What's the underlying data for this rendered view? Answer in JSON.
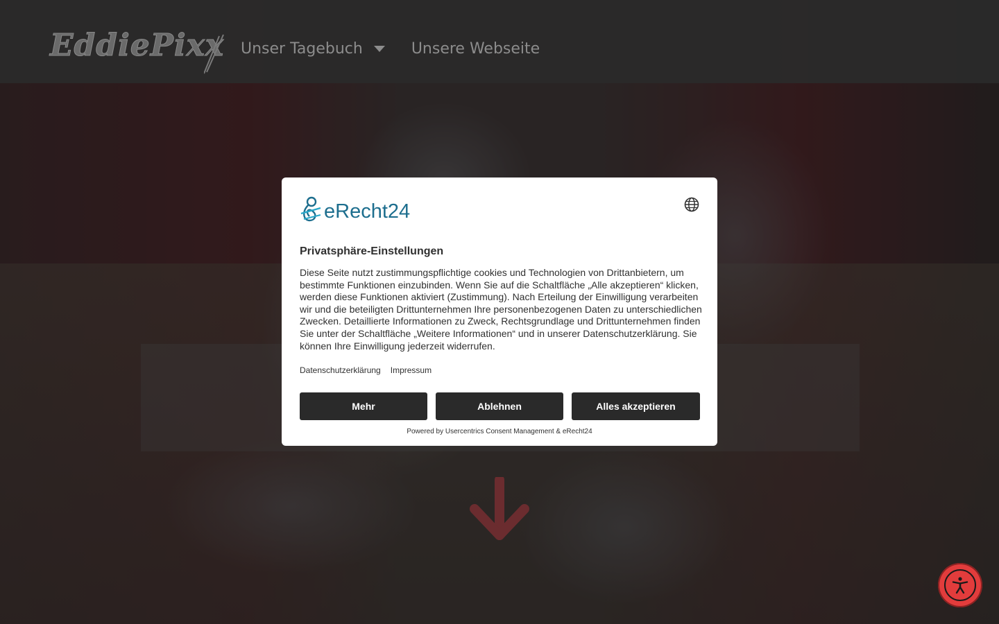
{
  "site": {
    "logo_text": "EddiePixx",
    "nav": [
      {
        "label": "Unser Tagebuch",
        "has_dropdown": true
      },
      {
        "label": "Unsere Webseite",
        "has_dropdown": false
      }
    ]
  },
  "consent": {
    "brand": "eRecht24",
    "title": "Privatsphäre-Einstellungen",
    "body": "Diese Seite nutzt zustimmungspflichtige cookies und Technologien von Drittanbietern, um bestimmte Funktionen einzubinden. Wenn Sie auf die Schaltfläche „Alle akzeptieren“ klicken, werden diese Funktionen aktiviert (Zustimmung). Nach Erteilung der Einwilligung verarbeiten wir und die beteiligten Drittunternehmen Ihre personenbezogenen Daten zu unterschiedlichen Zwecken. Detaillierte Informationen zu Zweck, Rechtsgrundlage und Drittunternehmen finden Sie unter der Schaltfläche „Weitere Informationen“ und in unserer Datenschutzerklärung. Sie können Ihre Einwilligung jederzeit widerrufen.",
    "links": {
      "privacy": "Datenschutzerklärung",
      "imprint": "Impressum"
    },
    "buttons": {
      "more": "Mehr",
      "decline": "Ablehnen",
      "accept_all": "Alles akzeptieren"
    },
    "powered_by": "Powered by Usercentrics Consent Management & eRecht24"
  },
  "colors": {
    "header_bg": "#2a2a2a",
    "button_bg": "#2a2a2a",
    "brand_teal": "#1d6e8e",
    "accessibility_red": "#e23c3c",
    "arrow_red": "#6b2c2f"
  },
  "icons": {
    "language": "globe-icon",
    "scroll": "arrow-down-icon",
    "accessibility": "accessibility-icon",
    "dropdown": "caret-down-icon"
  }
}
